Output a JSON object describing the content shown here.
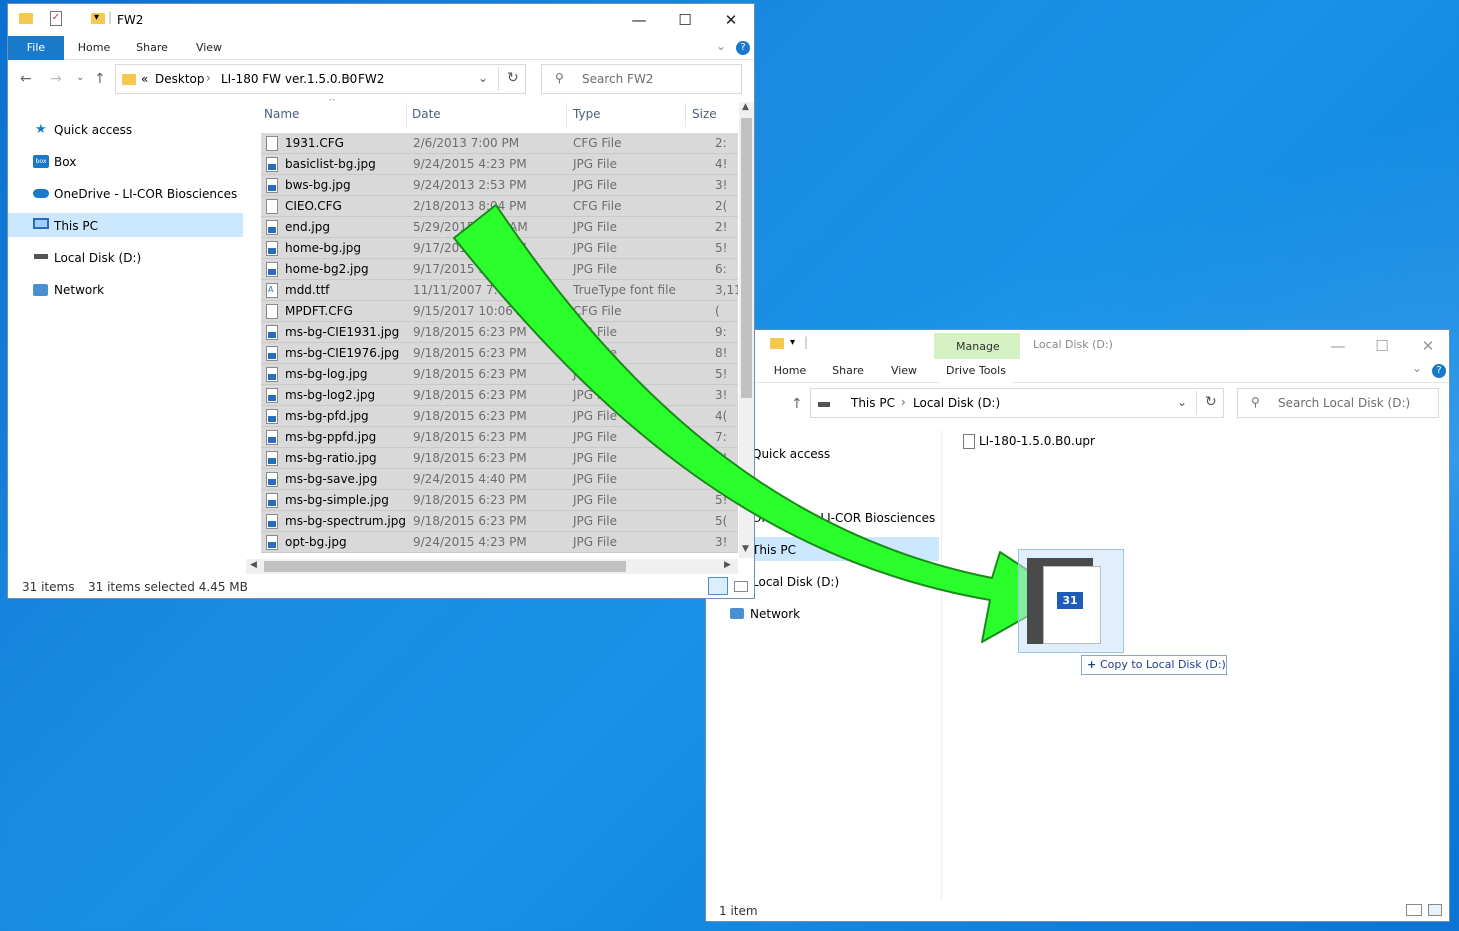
{
  "win1": {
    "title": "FW2",
    "tabs": {
      "file": "File",
      "home": "Home",
      "share": "Share",
      "view": "View"
    },
    "breadcrumb": [
      "«",
      "Desktop",
      "LI-180 FW ver.1.5.0.B0",
      "FW2"
    ],
    "search_placeholder": "Search FW2",
    "nav": [
      "Quick access",
      "Box",
      "OneDrive - LI-COR Biosciences",
      "This PC",
      "Local Disk (D:)",
      "Network"
    ],
    "columns": {
      "name": "Name",
      "date": "Date",
      "type": "Type",
      "size": "Size"
    },
    "files": [
      {
        "name": "1931.CFG",
        "date": "2/6/2013 7:00 PM",
        "type": "CFG File",
        "size": "2:",
        "kind": "doc"
      },
      {
        "name": "basiclist-bg.jpg",
        "date": "9/24/2015 4:23 PM",
        "type": "JPG File",
        "size": "4!",
        "kind": "img"
      },
      {
        "name": "bws-bg.jpg",
        "date": "9/24/2013 2:53 PM",
        "type": "JPG File",
        "size": "3!",
        "kind": "img"
      },
      {
        "name": "CIEO.CFG",
        "date": "2/18/2013 8:04 PM",
        "type": "CFG File",
        "size": "2(",
        "kind": "doc"
      },
      {
        "name": "end.jpg",
        "date": "5/29/2015 4:36 AM",
        "type": "JPG File",
        "size": "2!",
        "kind": "img"
      },
      {
        "name": "home-bg.jpg",
        "date": "9/17/2015 3:00 PM",
        "type": "JPG File",
        "size": "5!",
        "kind": "img"
      },
      {
        "name": "home-bg2.jpg",
        "date": "9/17/2015 3:00 PM",
        "type": "JPG File",
        "size": "6:",
        "kind": "img"
      },
      {
        "name": "mdd.ttf",
        "date": "11/11/2007 7:46 PM",
        "type": "TrueType font file",
        "size": "3,11:",
        "kind": "font"
      },
      {
        "name": "MPDFT.CFG",
        "date": "9/15/2017 10:06 AM",
        "type": "CFG File",
        "size": "(",
        "kind": "doc"
      },
      {
        "name": "ms-bg-CIE1931.jpg",
        "date": "9/18/2015 6:23 PM",
        "type": "JPG File",
        "size": "9:",
        "kind": "img"
      },
      {
        "name": "ms-bg-CIE1976.jpg",
        "date": "9/18/2015 6:23 PM",
        "type": "JPG File",
        "size": "8!",
        "kind": "img"
      },
      {
        "name": "ms-bg-log.jpg",
        "date": "9/18/2015 6:23 PM",
        "type": "JPG File",
        "size": "5!",
        "kind": "img"
      },
      {
        "name": "ms-bg-log2.jpg",
        "date": "9/18/2015 6:23 PM",
        "type": "JPG File",
        "size": "3!",
        "kind": "img"
      },
      {
        "name": "ms-bg-pfd.jpg",
        "date": "9/18/2015 6:23 PM",
        "type": "JPG File",
        "size": "4(",
        "kind": "img"
      },
      {
        "name": "ms-bg-ppfd.jpg",
        "date": "9/18/2015 6:23 PM",
        "type": "JPG File",
        "size": "7:",
        "kind": "img"
      },
      {
        "name": "ms-bg-ratio.jpg",
        "date": "9/18/2015 6:23 PM",
        "type": "JPG File",
        "size": "5!",
        "kind": "img"
      },
      {
        "name": "ms-bg-save.jpg",
        "date": "9/24/2015 4:40 PM",
        "type": "JPG File",
        "size": "4!",
        "kind": "img"
      },
      {
        "name": "ms-bg-simple.jpg",
        "date": "9/18/2015 6:23 PM",
        "type": "JPG File",
        "size": "5!",
        "kind": "img"
      },
      {
        "name": "ms-bg-spectrum.jpg",
        "date": "9/18/2015 6:23 PM",
        "type": "JPG File",
        "size": "5(",
        "kind": "img"
      },
      {
        "name": "opt-bg.jpg",
        "date": "9/24/2015 4:23 PM",
        "type": "JPG File",
        "size": "3!",
        "kind": "img"
      }
    ],
    "status_items": "31 items",
    "status_selected": "31 items selected  4.45 MB"
  },
  "win2": {
    "title": "Local Disk (D:)",
    "manage": "Manage",
    "drive_tools": "Drive Tools",
    "tabs": {
      "home": "Home",
      "share": "Share",
      "view": "View"
    },
    "breadcrumb": [
      "This PC",
      "Local Disk (D:)"
    ],
    "search_placeholder": "Search Local Disk (D:)",
    "nav": [
      "Quick access",
      "OneDrive - LI-COR Biosciences",
      "This PC",
      "Local Disk (D:)",
      "Network"
    ],
    "file": "LI-180-1.5.0.B0.upr",
    "status_items": "1 item"
  },
  "drag": {
    "count": "31",
    "tooltip": "Copy to Local Disk (D:)"
  },
  "colors": {
    "arrow": "#2bff2b",
    "accent": "#1979ca",
    "selected_row": "#d9d9d9",
    "manage_tab": "#d5f0c2"
  }
}
